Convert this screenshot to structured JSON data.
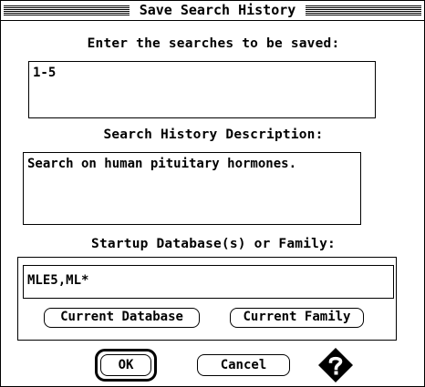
{
  "dialog": {
    "title": "Save Search History",
    "searches_label": "Enter the searches to be saved:",
    "searches_value": "1-5",
    "description_label": "Search History Description:",
    "description_value": "Search on human pituitary hormones.",
    "startup_label": "Startup Database(s) or Family:",
    "startup_value": "MLE5,ML*",
    "current_database_label": "Current Database",
    "current_family_label": "Current Family",
    "ok_label": "OK",
    "cancel_label": "Cancel",
    "help_icon": "help-diamond-icon"
  }
}
